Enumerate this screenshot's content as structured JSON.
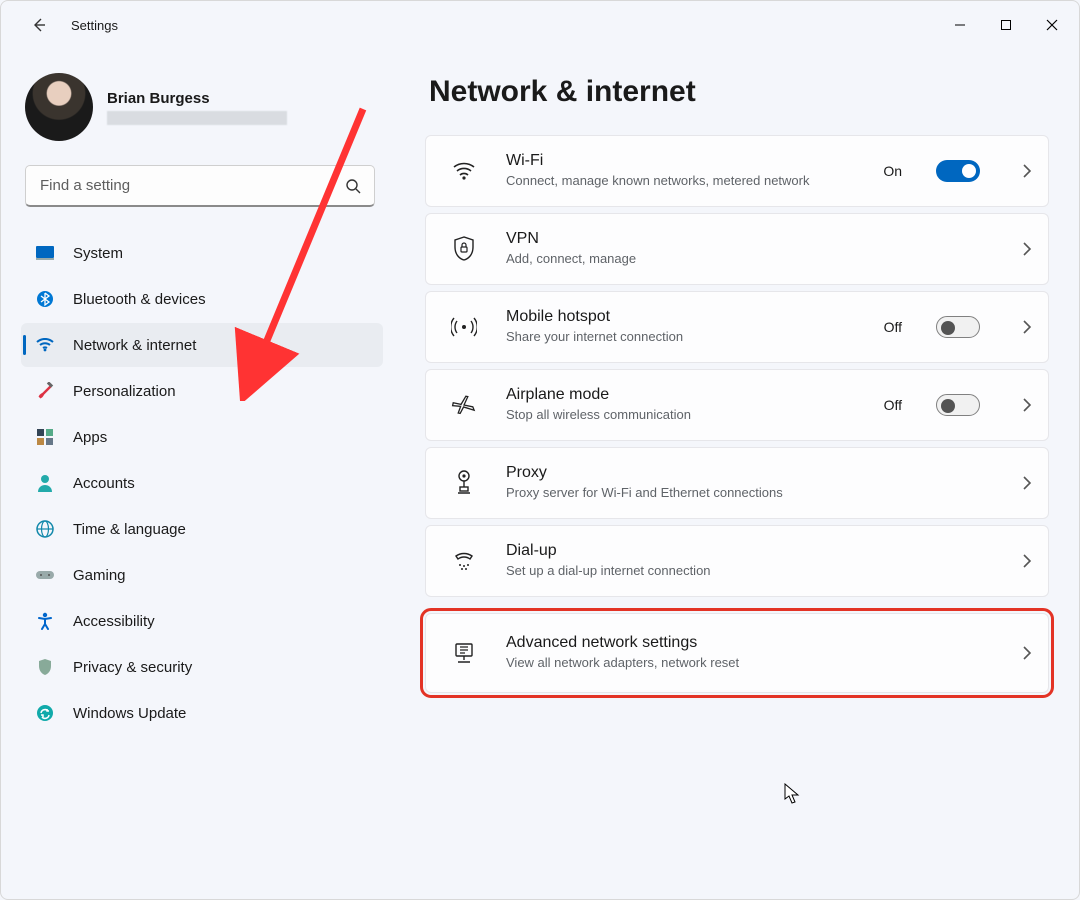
{
  "window": {
    "title": "Settings"
  },
  "profile": {
    "name": "Brian Burgess"
  },
  "search": {
    "placeholder": "Find a setting"
  },
  "sidebar": {
    "items": [
      {
        "label": "System"
      },
      {
        "label": "Bluetooth & devices"
      },
      {
        "label": "Network & internet"
      },
      {
        "label": "Personalization"
      },
      {
        "label": "Apps"
      },
      {
        "label": "Accounts"
      },
      {
        "label": "Time & language"
      },
      {
        "label": "Gaming"
      },
      {
        "label": "Accessibility"
      },
      {
        "label": "Privacy & security"
      },
      {
        "label": "Windows Update"
      }
    ]
  },
  "main": {
    "title": "Network & internet",
    "cards": [
      {
        "title": "Wi-Fi",
        "sub": "Connect, manage known networks, metered network",
        "state_label": "On",
        "toggle": "on"
      },
      {
        "title": "VPN",
        "sub": "Add, connect, manage"
      },
      {
        "title": "Mobile hotspot",
        "sub": "Share your internet connection",
        "state_label": "Off",
        "toggle": "off"
      },
      {
        "title": "Airplane mode",
        "sub": "Stop all wireless communication",
        "state_label": "Off",
        "toggle": "off"
      },
      {
        "title": "Proxy",
        "sub": "Proxy server for Wi-Fi and Ethernet connections"
      },
      {
        "title": "Dial-up",
        "sub": "Set up a dial-up internet connection"
      },
      {
        "title": "Advanced network settings",
        "sub": "View all network adapters, network reset"
      }
    ]
  }
}
